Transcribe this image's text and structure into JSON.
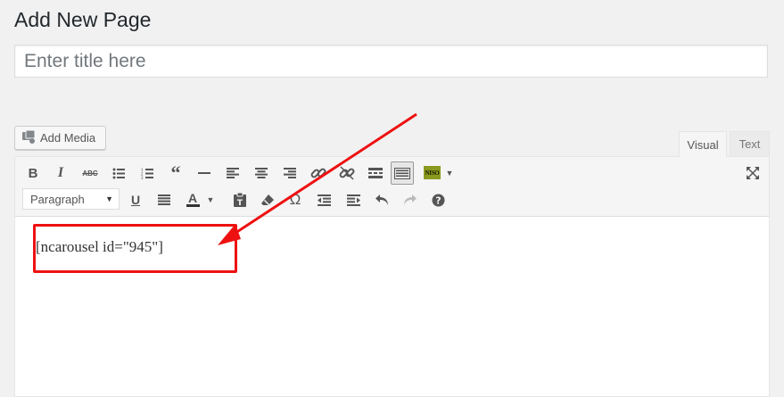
{
  "page": {
    "title": "Add New Page"
  },
  "title_field": {
    "placeholder": "Enter title here",
    "value": ""
  },
  "media": {
    "add_media_label": "Add Media"
  },
  "editor_tabs": {
    "visual": "Visual",
    "text": "Text"
  },
  "toolbar": {
    "row1": [
      "bold-icon",
      "italic-icon",
      "strikethrough-icon",
      "bullet-list-icon",
      "numbered-list-icon",
      "blockquote-icon",
      "horizontal-line-icon",
      "align-left-icon",
      "align-center-icon",
      "align-right-icon",
      "insert-link-icon",
      "remove-link-icon",
      "read-more-icon",
      "toolbar-toggle-icon",
      "niso-plugin-icon",
      "dropdown-arrow-icon",
      "fullscreen-icon"
    ],
    "row2": [
      "paragraph-select",
      "underline-icon",
      "justify-icon",
      "text-color-icon",
      "paste-text-icon",
      "clear-formatting-icon",
      "special-character-icon",
      "outdent-icon",
      "indent-icon",
      "undo-icon",
      "redo-icon",
      "help-icon"
    ],
    "format_value": "Paragraph",
    "niso_label": "NISO"
  },
  "content": {
    "shortcode": "[ncarousel id=\"945\"]"
  },
  "colors": {
    "annotation": "#e11111",
    "accent": "#0073aa"
  }
}
